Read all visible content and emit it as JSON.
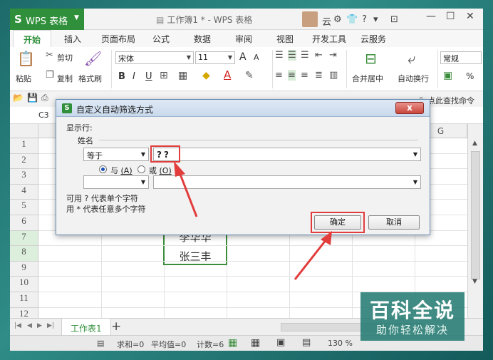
{
  "app": {
    "logo": "S",
    "name": "WPS 表格",
    "doc_title": "工作簿1 * - WPS 表格",
    "user_initial": "云",
    "help": "?"
  },
  "ribbon_tabs": [
    "开始",
    "插入",
    "页面布局",
    "公式",
    "数据",
    "审阅",
    "视图",
    "开发工具",
    "云服务"
  ],
  "ribbon": {
    "paste": "粘贴",
    "cut": "剪切",
    "copy": "复制",
    "format_painter": "格式刷",
    "font_name": "宋体",
    "font_size": "11",
    "bold": "B",
    "italic": "I",
    "underline": "U",
    "font_grow": "A",
    "font_shrink": "A",
    "merge_center": "合并居中",
    "wrap_text": "自动换行",
    "number_format": "常规",
    "percent": "%"
  },
  "quickbar": {
    "find_command": "点此查找命令"
  },
  "formula_bar": {
    "cell_ref": "C3"
  },
  "sheet": {
    "col_g": "G",
    "rows": [
      "1",
      "2",
      "3",
      "4",
      "5",
      "6",
      "7",
      "8",
      "9",
      "10",
      "11",
      "12"
    ],
    "cell_c7": "李华华",
    "cell_c8": "张三丰",
    "tab_name": "工作表1",
    "add_tab": "+"
  },
  "status_bar": {
    "sum": "求和=0",
    "average": "平均值=0",
    "count": "计数=6",
    "zoom": "130 %"
  },
  "dialog": {
    "title": "自定义自动筛选方式",
    "close": "x",
    "show_rows": "显示行:",
    "field_name": "姓名",
    "operator1": "等于",
    "value1": "??",
    "and_label": "与",
    "and_key": "(A)",
    "or_label": "或",
    "or_key": "(O)",
    "hint1": "可用 ? 代表单个字符",
    "hint2": "用 * 代表任意多个字符",
    "ok": "确定",
    "cancel": "取消"
  },
  "watermark": {
    "title": "百科全说",
    "subtitle": "助你轻松解决"
  },
  "colors": {
    "brand_green": "#2f8f3a",
    "highlight_red": "#e23c3c",
    "selection_green": "#3c8d3c"
  }
}
